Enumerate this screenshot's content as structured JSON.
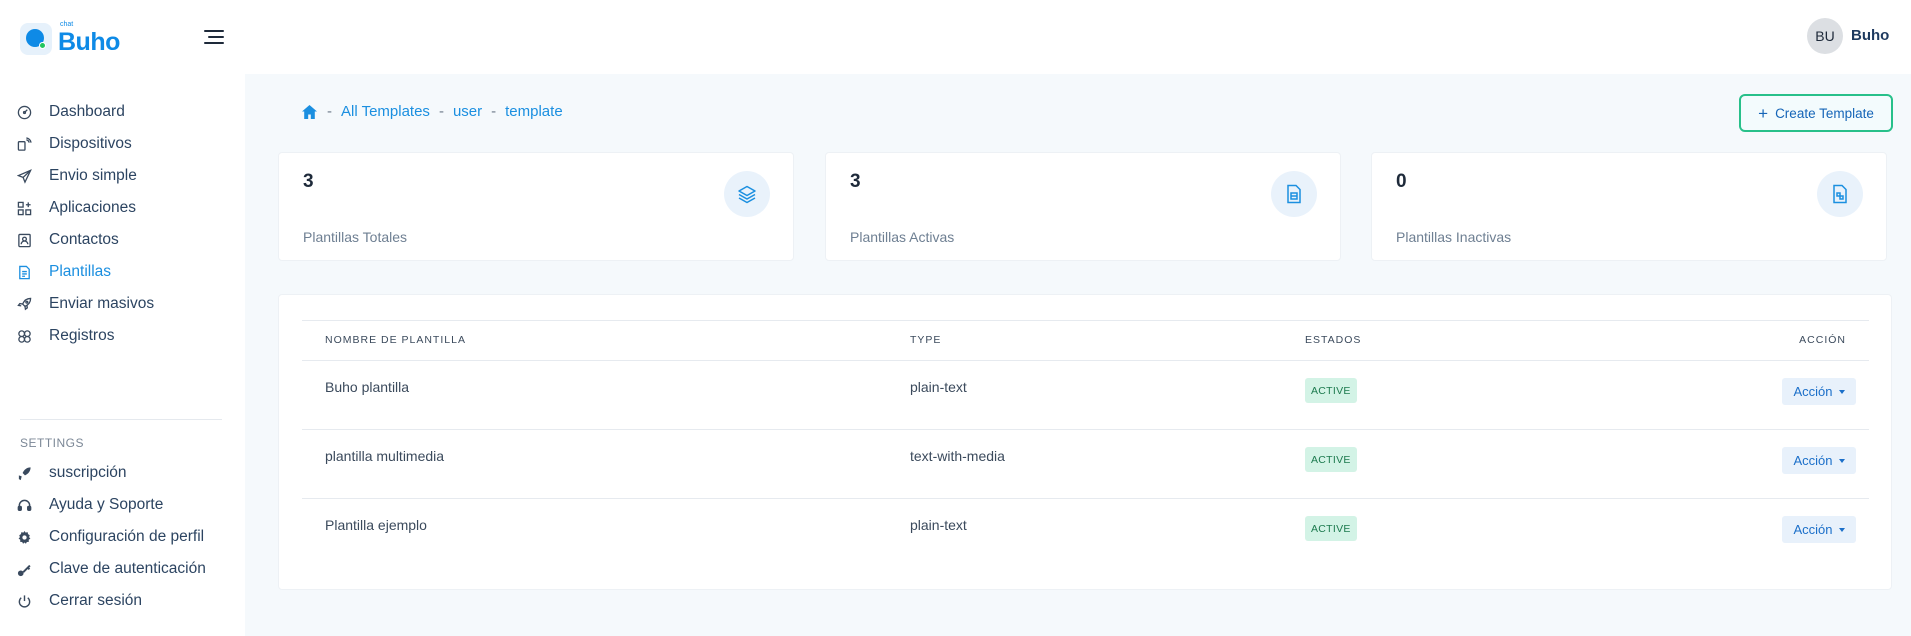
{
  "brand": {
    "small": "chat",
    "name": "Buho",
    "accent": "#0e8ae6"
  },
  "user": {
    "initials": "BU",
    "name": "Buho"
  },
  "sidebar": {
    "items": [
      {
        "label": "Dashboard",
        "icon": "gauge-icon",
        "active": false
      },
      {
        "label": "Dispositivos",
        "icon": "devices-icon",
        "active": false
      },
      {
        "label": "Envio simple",
        "icon": "send-icon",
        "active": false
      },
      {
        "label": "Aplicaciones",
        "icon": "apps-icon",
        "active": false
      },
      {
        "label": "Contactos",
        "icon": "contact-icon",
        "active": false
      },
      {
        "label": "Plantillas",
        "icon": "template-icon",
        "active": true
      },
      {
        "label": "Enviar masivos",
        "icon": "rocket-icon",
        "active": false
      },
      {
        "label": "Registros",
        "icon": "records-icon",
        "active": false
      }
    ],
    "settings_title": "SETTINGS",
    "settings_items": [
      {
        "label": "suscripción",
        "icon": "subscription-icon"
      },
      {
        "label": "Ayuda y Soporte",
        "icon": "headset-icon"
      },
      {
        "label": "Configuración de perfil",
        "icon": "gear-icon"
      },
      {
        "label": "Clave de autenticación",
        "icon": "key-icon"
      },
      {
        "label": "Cerrar sesión",
        "icon": "power-icon"
      }
    ]
  },
  "breadcrumb": {
    "items": [
      "All Templates",
      "user",
      "template"
    ],
    "separator": "-"
  },
  "create_button": {
    "label": "Create Template"
  },
  "stats": [
    {
      "value": "3",
      "label": "Plantillas Totales",
      "icon": "layers-icon"
    },
    {
      "value": "3",
      "label": "Plantillas Activas",
      "icon": "file-active-icon"
    },
    {
      "value": "0",
      "label": "Plantillas Inactivas",
      "icon": "file-inactive-icon"
    }
  ],
  "table": {
    "headers": {
      "name": "NOMBRE DE PLANTILLA",
      "type": "TYPE",
      "status": "ESTADOS",
      "action": "ACCIÓN"
    },
    "rows": [
      {
        "name": "Buho plantilla",
        "type": "plain-text",
        "status": "ACTIVE",
        "action": "Acción"
      },
      {
        "name": "plantilla multimedia",
        "type": "text-with-media",
        "status": "ACTIVE",
        "action": "Acción"
      },
      {
        "name": "Plantilla ejemplo",
        "type": "plain-text",
        "status": "ACTIVE",
        "action": "Acción"
      }
    ]
  }
}
